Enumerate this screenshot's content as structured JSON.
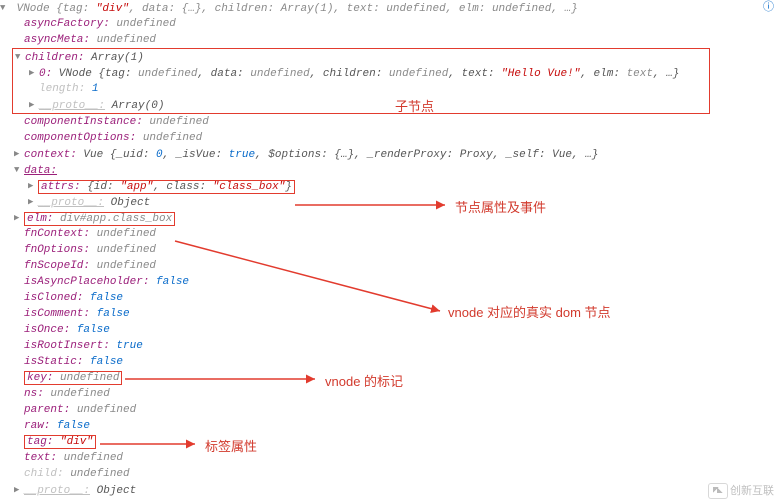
{
  "root_summary_prefix": "VNode {tag: ",
  "root_tag_str": "\"div\"",
  "root_summary_mid1": ", data: {…}, children: Array(1), text: ",
  "root_text_undef": "undefined",
  "root_summary_mid2": ", elm: ",
  "root_elm_undef": "undefined",
  "root_summary_tail": ", …}",
  "icon_info": "ⓘ",
  "p_asyncFactory": "asyncFactory:",
  "p_asyncMeta": "asyncMeta:",
  "p_children": "children:",
  "v_array1": " Array(1)",
  "p_idx0": "0:",
  "child0_summary_a": " VNode {tag: ",
  "child0_tag": "undefined",
  "child0_summary_b": ", data: ",
  "child0_data": "undefined",
  "child0_summary_c": ", children: ",
  "child0_children": "undefined",
  "child0_summary_d": ", text: ",
  "child0_text": "\"Hello Vue!\"",
  "child0_summary_e": ", elm: ",
  "child0_elm": "text",
  "child0_summary_f": ", …}",
  "p_length": "length:",
  "v_length": " 1",
  "p_proto": "__proto__:",
  "v_array0": " Array(0)",
  "p_componentInstance": "componentInstance:",
  "p_componentOptions": "componentOptions:",
  "p_context": "context:",
  "v_context": " Vue {_uid: 0, _isVue: true, $options: {…}, _renderProxy: Proxy, _self: Vue, …}",
  "v_context_uid": "0",
  "v_context_isVue": "true",
  "p_data": "data:",
  "p_attrs": "attrs:",
  "attrs_open": " {id: ",
  "attrs_id": "\"app\"",
  "attrs_mid": ", class: ",
  "attrs_class": "\"class_box\"",
  "attrs_close": "}",
  "v_object": " Object",
  "p_elm": "elm:",
  "v_elm": " div#app.class_box",
  "p_fnContext": "fnContext:",
  "p_fnOptions": "fnOptions:",
  "p_fnScopeId": "fnScopeId:",
  "p_isAsyncPlaceholder": "isAsyncPlaceholder:",
  "p_isCloned": "isCloned:",
  "p_isComment": "isComment:",
  "p_isOnce": "isOnce:",
  "p_isRootInsert": "isRootInsert:",
  "p_isStatic": "isStatic:",
  "p_key": "key:",
  "p_ns": "ns:",
  "p_parent": "parent:",
  "p_raw": "raw:",
  "p_tag": "tag:",
  "v_tag": " \"div\"",
  "p_text": "text:",
  "p_child": "child:",
  "v_undef": " undefined",
  "v_false": " false",
  "v_true": " true",
  "anno_children": "子节点",
  "anno_attrs": "节点属性及事件",
  "anno_elm": "vnode 对应的真实 dom 节点",
  "anno_key": "vnode 的标记",
  "anno_tag": "标签属性",
  "watermark": "创新互联"
}
